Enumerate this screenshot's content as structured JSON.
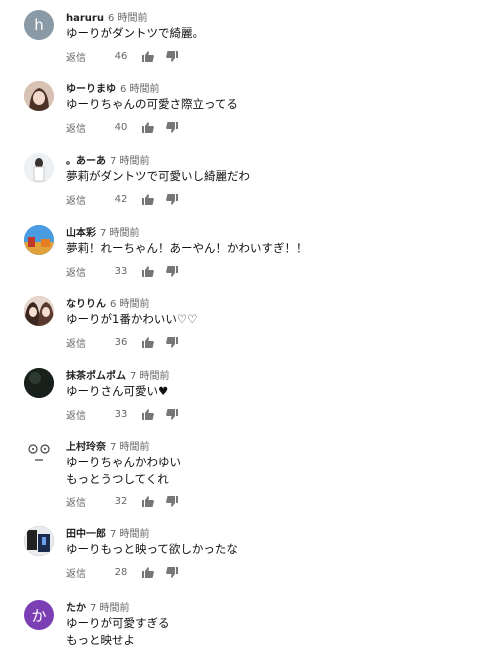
{
  "comments": [
    {
      "author": "haruru",
      "time": "6 時間前",
      "lines": [
        "ゆーりがダントツで綺麗。"
      ],
      "reply": "返信",
      "likes": "46",
      "avatar": {
        "type": "letter",
        "letter": "h",
        "color": "#8a9aa6"
      }
    },
    {
      "author": "ゆーりまゆ",
      "time": "6 時間前",
      "lines": [
        "ゆーりちゃんの可愛さ際立ってる"
      ],
      "reply": "返信",
      "likes": "40",
      "avatar": {
        "type": "photo",
        "color": "#c9a48e"
      }
    },
    {
      "author": "。あーあ",
      "time": "7 時間前",
      "lines": [
        "夢莉がダントツで可愛いし綺麗だわ"
      ],
      "reply": "返信",
      "likes": "42",
      "avatar": {
        "type": "photo",
        "color": "#dfe5ea"
      }
    },
    {
      "author": "山本彩",
      "time": "7 時間前",
      "lines": [
        "夢莉！れーちゃん！あーやん！かわいすぎ！！"
      ],
      "reply": "返信",
      "likes": "33",
      "avatar": {
        "type": "photo",
        "color": "#3d8fd6"
      }
    },
    {
      "author": "なりりん",
      "time": "6 時間前",
      "lines": [
        "ゆーりが1番かわいい♡♡"
      ],
      "reply": "返信",
      "likes": "36",
      "avatar": {
        "type": "photo",
        "color": "#b98c7b"
      }
    },
    {
      "author": "抹茶ポムポム",
      "time": "7 時間前",
      "lines": [
        "ゆーりさん可愛い♥"
      ],
      "reply": "返信",
      "likes": "33",
      "avatar": {
        "type": "photo",
        "color": "#1f2a24"
      }
    },
    {
      "author": "上村玲奈",
      "time": "7 時間前",
      "lines": [
        "ゆーりちゃんかわゆい",
        "もっとうつしてくれ"
      ],
      "reply": "返信",
      "likes": "32",
      "avatar": {
        "type": "face",
        "color": "#ffffff"
      }
    },
    {
      "author": "田中一郎",
      "time": "7 時間前",
      "lines": [
        "ゆーりもっと映って欲しかったな"
      ],
      "reply": "返信",
      "likes": "28",
      "avatar": {
        "type": "photo",
        "color": "#2d3140"
      }
    },
    {
      "author": "たか",
      "time": "7 時間前",
      "lines": [
        "ゆーりが可愛すぎる",
        "もっと映せよ"
      ],
      "reply": "返信",
      "likes": "",
      "avatar": {
        "type": "letter",
        "letter": "か",
        "color": "#7b3fb3"
      }
    }
  ]
}
